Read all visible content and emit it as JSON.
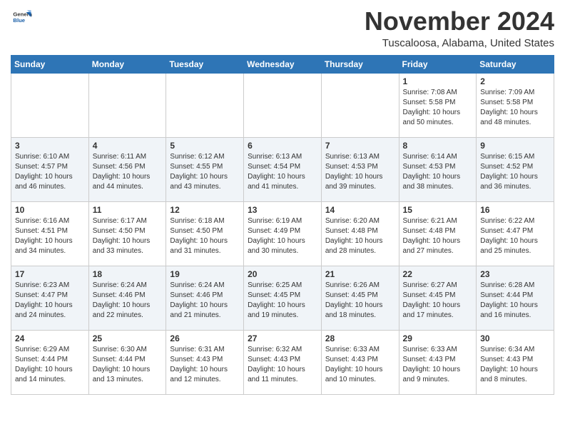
{
  "header": {
    "logo_general": "General",
    "logo_blue": "Blue",
    "month_title": "November 2024",
    "location": "Tuscaloosa, Alabama, United States"
  },
  "weekdays": [
    "Sunday",
    "Monday",
    "Tuesday",
    "Wednesday",
    "Thursday",
    "Friday",
    "Saturday"
  ],
  "weeks": [
    [
      {
        "day": "",
        "info": ""
      },
      {
        "day": "",
        "info": ""
      },
      {
        "day": "",
        "info": ""
      },
      {
        "day": "",
        "info": ""
      },
      {
        "day": "",
        "info": ""
      },
      {
        "day": "1",
        "info": "Sunrise: 7:08 AM\nSunset: 5:58 PM\nDaylight: 10 hours\nand 50 minutes."
      },
      {
        "day": "2",
        "info": "Sunrise: 7:09 AM\nSunset: 5:58 PM\nDaylight: 10 hours\nand 48 minutes."
      }
    ],
    [
      {
        "day": "3",
        "info": "Sunrise: 6:10 AM\nSunset: 4:57 PM\nDaylight: 10 hours\nand 46 minutes."
      },
      {
        "day": "4",
        "info": "Sunrise: 6:11 AM\nSunset: 4:56 PM\nDaylight: 10 hours\nand 44 minutes."
      },
      {
        "day": "5",
        "info": "Sunrise: 6:12 AM\nSunset: 4:55 PM\nDaylight: 10 hours\nand 43 minutes."
      },
      {
        "day": "6",
        "info": "Sunrise: 6:13 AM\nSunset: 4:54 PM\nDaylight: 10 hours\nand 41 minutes."
      },
      {
        "day": "7",
        "info": "Sunrise: 6:13 AM\nSunset: 4:53 PM\nDaylight: 10 hours\nand 39 minutes."
      },
      {
        "day": "8",
        "info": "Sunrise: 6:14 AM\nSunset: 4:53 PM\nDaylight: 10 hours\nand 38 minutes."
      },
      {
        "day": "9",
        "info": "Sunrise: 6:15 AM\nSunset: 4:52 PM\nDaylight: 10 hours\nand 36 minutes."
      }
    ],
    [
      {
        "day": "10",
        "info": "Sunrise: 6:16 AM\nSunset: 4:51 PM\nDaylight: 10 hours\nand 34 minutes."
      },
      {
        "day": "11",
        "info": "Sunrise: 6:17 AM\nSunset: 4:50 PM\nDaylight: 10 hours\nand 33 minutes."
      },
      {
        "day": "12",
        "info": "Sunrise: 6:18 AM\nSunset: 4:50 PM\nDaylight: 10 hours\nand 31 minutes."
      },
      {
        "day": "13",
        "info": "Sunrise: 6:19 AM\nSunset: 4:49 PM\nDaylight: 10 hours\nand 30 minutes."
      },
      {
        "day": "14",
        "info": "Sunrise: 6:20 AM\nSunset: 4:48 PM\nDaylight: 10 hours\nand 28 minutes."
      },
      {
        "day": "15",
        "info": "Sunrise: 6:21 AM\nSunset: 4:48 PM\nDaylight: 10 hours\nand 27 minutes."
      },
      {
        "day": "16",
        "info": "Sunrise: 6:22 AM\nSunset: 4:47 PM\nDaylight: 10 hours\nand 25 minutes."
      }
    ],
    [
      {
        "day": "17",
        "info": "Sunrise: 6:23 AM\nSunset: 4:47 PM\nDaylight: 10 hours\nand 24 minutes."
      },
      {
        "day": "18",
        "info": "Sunrise: 6:24 AM\nSunset: 4:46 PM\nDaylight: 10 hours\nand 22 minutes."
      },
      {
        "day": "19",
        "info": "Sunrise: 6:24 AM\nSunset: 4:46 PM\nDaylight: 10 hours\nand 21 minutes."
      },
      {
        "day": "20",
        "info": "Sunrise: 6:25 AM\nSunset: 4:45 PM\nDaylight: 10 hours\nand 19 minutes."
      },
      {
        "day": "21",
        "info": "Sunrise: 6:26 AM\nSunset: 4:45 PM\nDaylight: 10 hours\nand 18 minutes."
      },
      {
        "day": "22",
        "info": "Sunrise: 6:27 AM\nSunset: 4:45 PM\nDaylight: 10 hours\nand 17 minutes."
      },
      {
        "day": "23",
        "info": "Sunrise: 6:28 AM\nSunset: 4:44 PM\nDaylight: 10 hours\nand 16 minutes."
      }
    ],
    [
      {
        "day": "24",
        "info": "Sunrise: 6:29 AM\nSunset: 4:44 PM\nDaylight: 10 hours\nand 14 minutes."
      },
      {
        "day": "25",
        "info": "Sunrise: 6:30 AM\nSunset: 4:44 PM\nDaylight: 10 hours\nand 13 minutes."
      },
      {
        "day": "26",
        "info": "Sunrise: 6:31 AM\nSunset: 4:43 PM\nDaylight: 10 hours\nand 12 minutes."
      },
      {
        "day": "27",
        "info": "Sunrise: 6:32 AM\nSunset: 4:43 PM\nDaylight: 10 hours\nand 11 minutes."
      },
      {
        "day": "28",
        "info": "Sunrise: 6:33 AM\nSunset: 4:43 PM\nDaylight: 10 hours\nand 10 minutes."
      },
      {
        "day": "29",
        "info": "Sunrise: 6:33 AM\nSunset: 4:43 PM\nDaylight: 10 hours\nand 9 minutes."
      },
      {
        "day": "30",
        "info": "Sunrise: 6:34 AM\nSunset: 4:43 PM\nDaylight: 10 hours\nand 8 minutes."
      }
    ]
  ]
}
